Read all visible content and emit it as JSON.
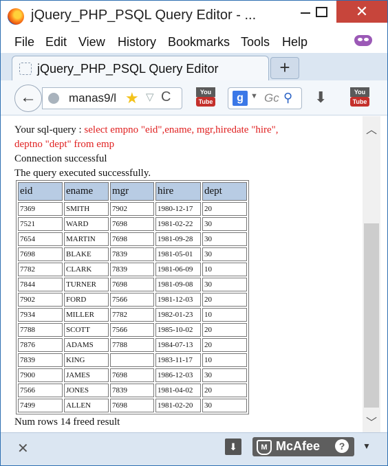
{
  "window": {
    "title": "jQuery_PHP_PSQL Query Editor - ...",
    "minimize": "",
    "maximize": "",
    "close": "✕"
  },
  "menu": [
    "File",
    "Edit",
    "View",
    "History",
    "Bookmarks",
    "Tools",
    "Help"
  ],
  "tab": {
    "title": "jQuery_PHP_PSQL Query Editor",
    "new_tab": "+"
  },
  "nav": {
    "back": "←",
    "url": "manas9/l",
    "star": "★",
    "dropdown": "▽",
    "reload": "C",
    "youtube_top": "You",
    "youtube_bottom": "Tube",
    "search_engine": "g",
    "search_dropdown": "▼",
    "search_placeholder": "Gc",
    "search_icon": "⚲",
    "download": "⬇"
  },
  "page": {
    "query_label": "Your sql-query : ",
    "query_line1": "select empno \"eid\",ename, mgr,hiredate \"hire\",",
    "query_line2": "deptno \"dept\" from emp",
    "conn_status": "Connection successful",
    "exec_status": "The query executed successfully.",
    "columns": [
      "eid",
      "ename",
      "mgr",
      "hire",
      "dept"
    ],
    "rows": [
      [
        "7369",
        "SMITH",
        "7902",
        "1980-12-17",
        "20"
      ],
      [
        "7521",
        "WARD",
        "7698",
        "1981-02-22",
        "30"
      ],
      [
        "7654",
        "MARTIN",
        "7698",
        "1981-09-28",
        "30"
      ],
      [
        "7698",
        "BLAKE",
        "7839",
        "1981-05-01",
        "30"
      ],
      [
        "7782",
        "CLARK",
        "7839",
        "1981-06-09",
        "10"
      ],
      [
        "7844",
        "TURNER",
        "7698",
        "1981-09-08",
        "30"
      ],
      [
        "7902",
        "FORD",
        "7566",
        "1981-12-03",
        "20"
      ],
      [
        "7934",
        "MILLER",
        "7782",
        "1982-01-23",
        "10"
      ],
      [
        "7788",
        "SCOTT",
        "7566",
        "1985-10-02",
        "20"
      ],
      [
        "7876",
        "ADAMS",
        "7788",
        "1984-07-13",
        "20"
      ],
      [
        "7839",
        "KING",
        "",
        "1983-11-17",
        "10"
      ],
      [
        "7900",
        "JAMES",
        "7698",
        "1986-12-03",
        "30"
      ],
      [
        "7566",
        "JONES",
        "7839",
        "1981-04-02",
        "20"
      ],
      [
        "7499",
        "ALLEN",
        "7698",
        "1981-02-20",
        "30"
      ]
    ],
    "footer": "Num rows 14 freed result"
  },
  "scrollbar": {
    "up": "︿",
    "down": "﹀"
  },
  "statusbar": {
    "close": "✕",
    "download": "⬇",
    "mcafee_label": "McAfee",
    "mcafee_help": "?",
    "mcafee_dropdown": "▼"
  },
  "icons": {
    "app": "firefox-icon",
    "addon": "mask-icon",
    "search_engine": "google-icon"
  },
  "colors": {
    "query_text": "#e02020",
    "header_bg": "#b8cce4",
    "close_button": "#c7453b"
  }
}
